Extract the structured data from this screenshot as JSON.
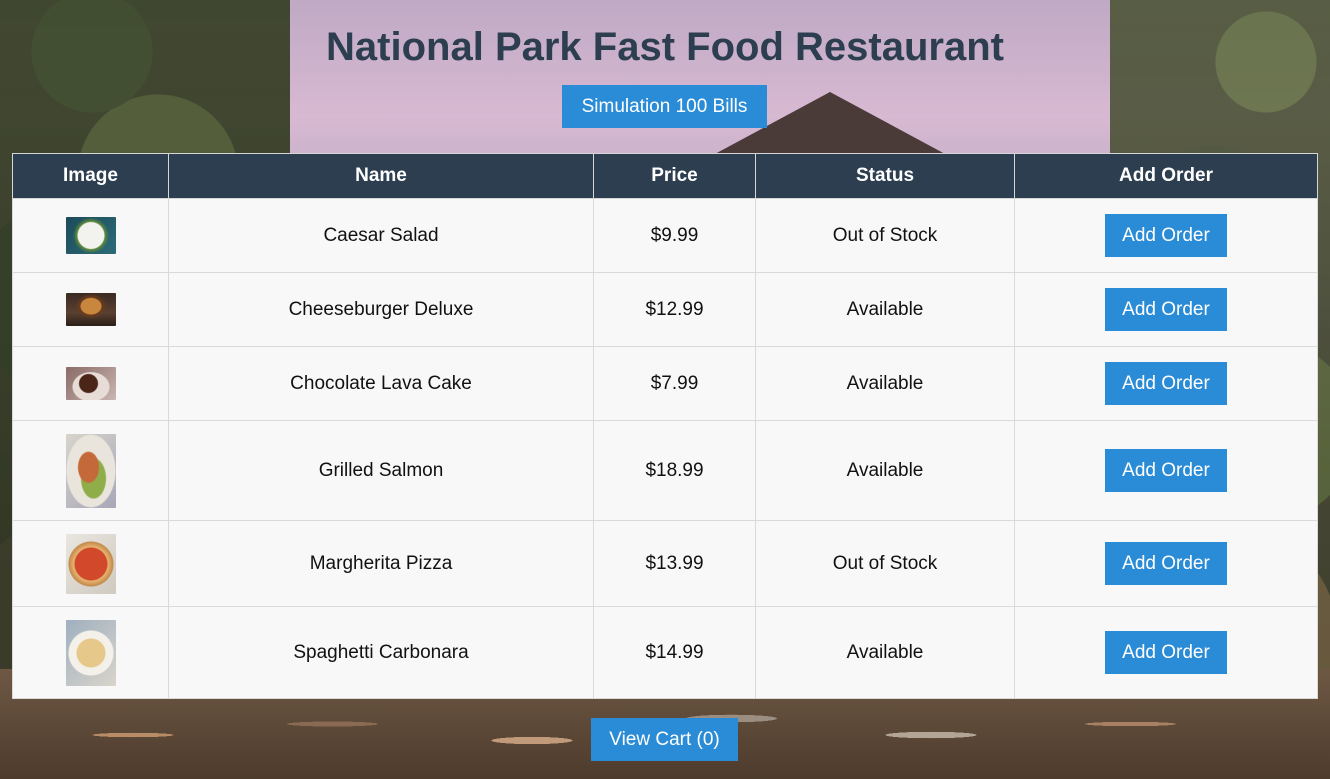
{
  "page": {
    "title": "National Park Fast Food Restaurant",
    "simulation_label": "Simulation 100 Bills",
    "cart_label": "View Cart (0)"
  },
  "colors": {
    "title": "#2c3e50",
    "header_bg": "#2c3e50",
    "button": "#2a8bd6"
  },
  "table": {
    "headers": [
      "Image",
      "Name",
      "Price",
      "Status",
      "Add Order"
    ],
    "rows": [
      {
        "name": "Caesar Salad",
        "price": "$9.99",
        "status": "Out of Stock",
        "button": "Add Order",
        "thumb": "salad-thumbnail"
      },
      {
        "name": "Cheeseburger Deluxe",
        "price": "$12.99",
        "status": "Available",
        "button": "Add Order",
        "thumb": "burger-thumbnail"
      },
      {
        "name": "Chocolate Lava Cake",
        "price": "$7.99",
        "status": "Available",
        "button": "Add Order",
        "thumb": "cake-thumbnail"
      },
      {
        "name": "Grilled Salmon",
        "price": "$18.99",
        "status": "Available",
        "button": "Add Order",
        "thumb": "salmon-thumbnail"
      },
      {
        "name": "Margherita Pizza",
        "price": "$13.99",
        "status": "Out of Stock",
        "button": "Add Order",
        "thumb": "pizza-thumbnail"
      },
      {
        "name": "Spaghetti Carbonara",
        "price": "$14.99",
        "status": "Available",
        "button": "Add Order",
        "thumb": "pasta-thumbnail"
      }
    ]
  }
}
